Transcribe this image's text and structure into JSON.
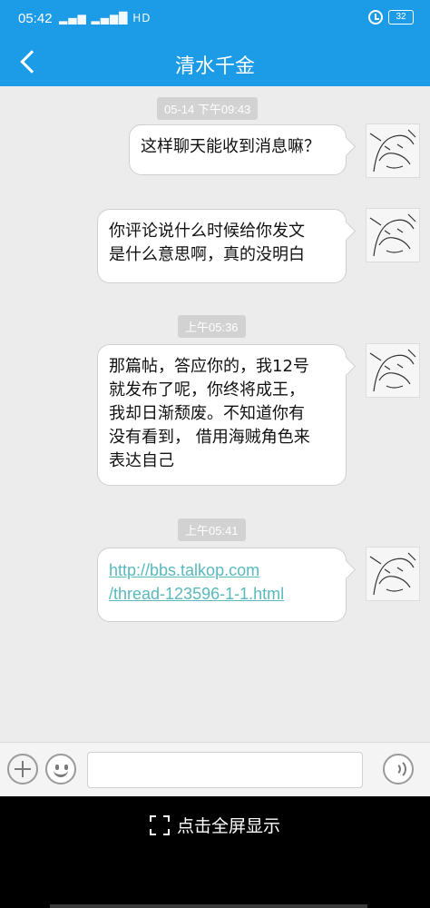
{
  "status_bar": {
    "time": "05:42",
    "network": "HD",
    "battery": "32"
  },
  "header": {
    "title": "清水千金"
  },
  "messages": [
    {
      "type": "timestamp",
      "text": "05-14 下午09:43"
    },
    {
      "type": "sent",
      "lines": [
        "这样聊天能收到消息嘛？"
      ]
    },
    {
      "type": "sent",
      "lines": [
        "你评论说什么时候给你发文",
        "是什么意思啊，真的没明白"
      ]
    },
    {
      "type": "timestamp",
      "text": "上午05:36"
    },
    {
      "type": "sent",
      "lines": [
        "那篇帖，答应你的，我12号",
        "就发布了呢，你终将成王，",
        "我却日渐颓废。不知道你有",
        "没有看到， 借用海贼角色来",
        "表达自己"
      ]
    },
    {
      "type": "timestamp",
      "text": "上午05:41"
    },
    {
      "type": "sent",
      "link_lines": [
        "http://bbs.talkop.com",
        "/thread-123596-1-1.html"
      ]
    }
  ],
  "input_bar": {
    "placeholder": "",
    "value": ""
  },
  "bottom": {
    "fullscreen_label": "点击全屏显示"
  }
}
